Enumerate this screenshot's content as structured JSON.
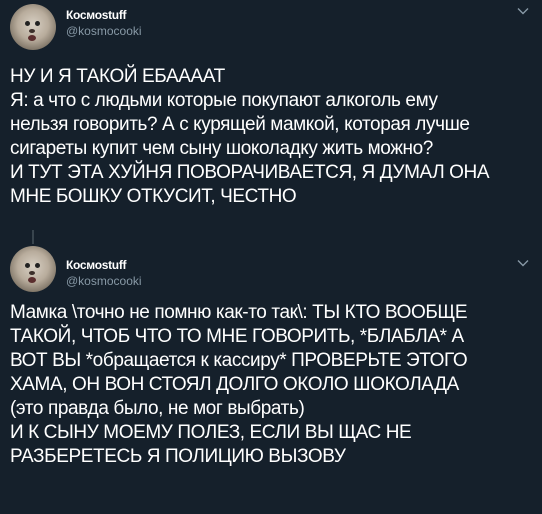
{
  "colors": {
    "background": "#15202b",
    "text": "#ffffff",
    "secondary": "#8899a6",
    "thread": "#38444d"
  },
  "tweets": [
    {
      "author_name": "Космоstuff",
      "author_handle": "@kosmocooki",
      "menu_icon": "chevron-down-icon",
      "lines": [
        "НУ И Я ТАКОЙ ЕБАААAT",
        "Я: а что с людьми которые покупают алкоголь ему",
        "нельзя говорить? А с курящей мамкой, которая лучше",
        "сигареты купит чем сыну шоколадку жить можно?",
        "И ТУТ ЭТА ХУЙНЯ ПОВОРАЧИВАЕТСЯ, Я ДУМАЛ ОНА",
        "МНЕ БОШКУ ОТКУСИТ, ЧЕСТНО"
      ]
    },
    {
      "author_name": "Космоstuff",
      "author_handle": "@kosmocooki",
      "menu_icon": "chevron-down-icon",
      "lines": [
        "Мамка \\точно не помню как-то так\\: ТЫ КТО ВООБЩЕ",
        "ТАКОЙ, ЧТОБ ЧТО ТО МНЕ ГОВОРИТЬ, *БЛАБЛА* А",
        "ВОТ ВЫ *обращается к кассиру* ПРОВЕРЬТЕ ЭТОГО",
        "ХАМА, ОН ВОН СТОЯЛ ДОЛГО ОКОЛО ШОКОЛАДА",
        "(это правда было, не мог выбрать)",
        "И К СЫНУ МОЕМУ ПОЛЕЗ, ЕСЛИ ВЫ ЩАС НЕ",
        "РАЗБЕРЕТЕСЬ Я ПОЛИЦИЮ ВЫЗОВУ"
      ]
    }
  ]
}
